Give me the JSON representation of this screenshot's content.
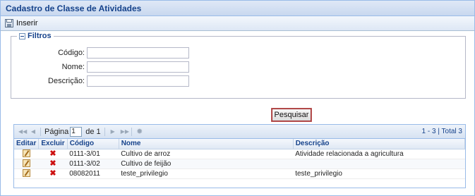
{
  "window": {
    "title": "Cadastro de Classe de Atividades"
  },
  "toolbar": {
    "insert_label": "Inserir"
  },
  "filters": {
    "legend": "Filtros",
    "codigo": {
      "label": "Código:",
      "value": ""
    },
    "nome": {
      "label": "Nome:",
      "value": ""
    },
    "descricao": {
      "label": "Descrição:",
      "value": ""
    },
    "search_label": "Pesquisar"
  },
  "pager": {
    "page_label": "Página",
    "page_value": "1",
    "of_label": "de 1",
    "summary": "1 - 3 | Total 3"
  },
  "grid": {
    "columns": [
      "Editar",
      "Excluir",
      "Código",
      "Nome",
      "Descrição"
    ],
    "rows": [
      {
        "codigo": "0111-3/01",
        "nome": "Cultivo de arroz",
        "descricao": "Atividade relacionada a agricultura"
      },
      {
        "codigo": "0111-3/02",
        "nome": "Cultivo de feijão",
        "descricao": ""
      },
      {
        "codigo": "08082011",
        "nome": "teste_privilegio",
        "descricao": "teste_privilegio"
      }
    ]
  },
  "icons": {
    "insert": "save-disk-icon",
    "edit": "edit-pencil-icon",
    "delete": "delete-x-icon"
  }
}
